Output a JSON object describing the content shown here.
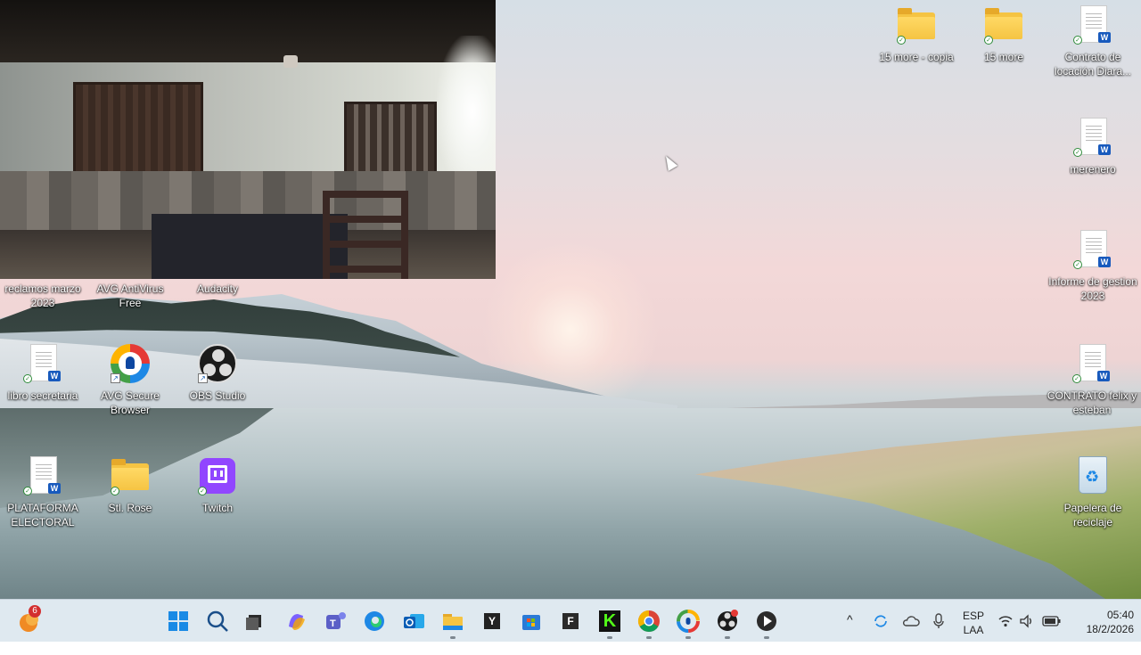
{
  "desktop": {
    "icons_left_row1": [
      {
        "label": "reclamos marzo 2023",
        "icon": "word-doc-icon"
      },
      {
        "label": "AVG AntiVirus Free",
        "icon": "avg-antivirus-icon"
      },
      {
        "label": "Audacity",
        "icon": "audacity-icon"
      }
    ],
    "icons_left_row2": [
      {
        "label": "libro secretaria",
        "icon": "word-doc-icon"
      },
      {
        "label": "AVG Secure Browser",
        "icon": "avg-secure-browser-icon"
      },
      {
        "label": "OBS Studio",
        "icon": "obs-studio-icon"
      }
    ],
    "icons_left_row3": [
      {
        "label": "PLATAFORMA ELECTORAL",
        "icon": "word-doc-icon"
      },
      {
        "label": "Stl. Rose",
        "icon": "folder-icon"
      },
      {
        "label": "Twitch",
        "icon": "twitch-icon"
      }
    ],
    "icons_top_right": [
      {
        "label": "15 more - copia",
        "icon": "folder-icon"
      },
      {
        "label": "15 more",
        "icon": "folder-icon"
      },
      {
        "label": "Contrato de locación Diara...",
        "icon": "word-doc-icon"
      }
    ],
    "icons_right_column": [
      {
        "label": "merenero",
        "icon": "word-doc-icon"
      },
      {
        "label": "Informe de gestion 2023",
        "icon": "word-doc-icon"
      },
      {
        "label": "CONTRATO felix y esteban",
        "icon": "word-doc-icon"
      },
      {
        "label": "Papelera de reciclaje",
        "icon": "recycle-bin-icon"
      }
    ],
    "word_badge": "W",
    "sync_check": "✓",
    "shortcut_arrow": "↗"
  },
  "taskbar": {
    "widget_badge": "6",
    "apps": [
      {
        "name": "start",
        "icon": "windows-start-icon"
      },
      {
        "name": "search",
        "icon": "search-icon"
      },
      {
        "name": "task-view",
        "icon": "task-view-icon"
      },
      {
        "name": "copilot",
        "icon": "copilot-icon"
      },
      {
        "name": "teams",
        "icon": "teams-icon"
      },
      {
        "name": "edge",
        "icon": "edge-icon"
      },
      {
        "name": "outlook",
        "icon": "outlook-icon"
      },
      {
        "name": "file-explorer",
        "icon": "folder-icon"
      },
      {
        "name": "y-app",
        "icon": "y-app-icon",
        "text": "Y"
      },
      {
        "name": "microsoft-store",
        "icon": "store-icon"
      },
      {
        "name": "f-app",
        "icon": "f-app-icon",
        "text": "F"
      },
      {
        "name": "kick",
        "icon": "kick-icon",
        "text": "K"
      },
      {
        "name": "chrome",
        "icon": "chrome-icon"
      },
      {
        "name": "avg-browser",
        "icon": "avg-secure-browser-icon"
      },
      {
        "name": "obs",
        "icon": "obs-studio-icon"
      },
      {
        "name": "media-player",
        "icon": "play-icon"
      }
    ],
    "tray": {
      "language_top": "ESP",
      "language_bottom": "LAA",
      "time": "05:40",
      "date": "18/2/2026",
      "chevron": "^"
    }
  },
  "colors": {
    "folder": "#f5c443",
    "word_blue": "#185abd",
    "twitch": "#9146ff",
    "taskbar_bg": "#dfe9f0"
  }
}
